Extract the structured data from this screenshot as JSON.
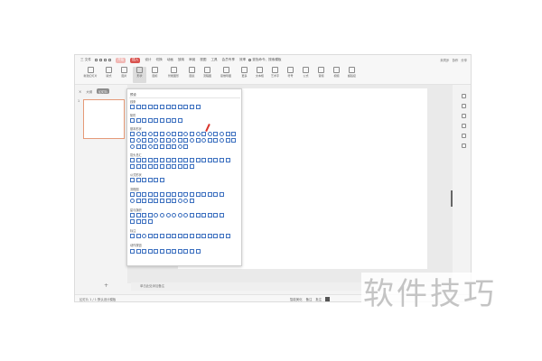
{
  "titlebar": {
    "file_label": "三 文件",
    "menus": [
      "开始",
      "插入",
      "设计",
      "切换",
      "动画",
      "放映",
      "审阅",
      "视图",
      "工具",
      "会员专享",
      "效率"
    ],
    "search_label": "查找命令、搜索模板",
    "right_items": [
      "未同步",
      "协作",
      "分享"
    ]
  },
  "toolbar": {
    "items": [
      "新建幻灯片",
      "版式",
      "图片",
      "形状",
      "图标",
      "智能图形",
      "图表",
      "流程图",
      "思维导图",
      "更多",
      "文本框",
      "艺术字",
      "符号",
      "公式",
      "音频",
      "视频",
      "超链接"
    ]
  },
  "leftpanel": {
    "tabs": [
      "大纲",
      "幻灯片"
    ],
    "slide_number": "1"
  },
  "dropdown": {
    "title": "预设",
    "sections": [
      {
        "label": "线条"
      },
      {
        "label": "矩形"
      },
      {
        "label": "基本形状"
      },
      {
        "label": "箭头总汇"
      },
      {
        "label": "公式形状"
      },
      {
        "label": "流程图"
      },
      {
        "label": "星与旗帜"
      },
      {
        "label": "标注"
      },
      {
        "label": "动作按钮"
      }
    ]
  },
  "notes": {
    "placeholder": "单击此处添加备注"
  },
  "statusbar": {
    "left": "幻灯片 1 / 1    默认设计模板",
    "right": [
      "智能美化",
      "备注",
      "批注"
    ]
  },
  "watermark": {
    "text": "软件技巧"
  },
  "colors": {
    "insert_tab": "#d9534f",
    "slide_border": "#e59a78",
    "shape_outline": "#3b6fbf"
  }
}
